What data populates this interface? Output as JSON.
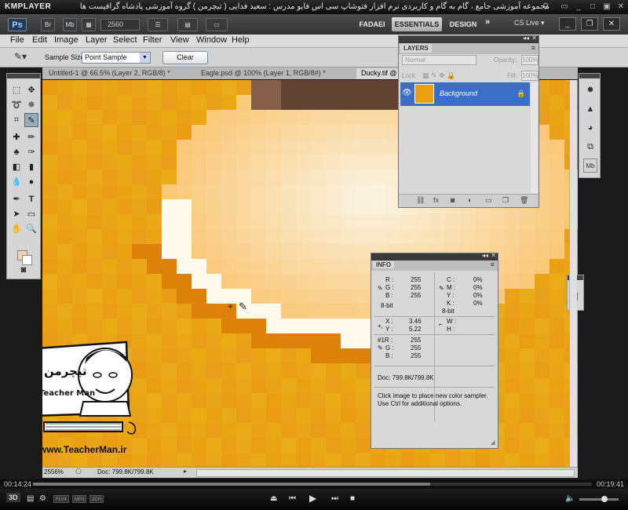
{
  "player": {
    "logo": "KMPLAYER",
    "title": "مجموعه آموزشی جامع ، گام به گام و کاربردی نرم افزار فتوشاپ سی اس فایو   مدرس : سعید فدایی ( تیچرمن ) گروه آموزشی پادشاه گرافیست ها",
    "time_current": "00:14:24",
    "time_total": "00:19:41",
    "progress": 0.71,
    "badges": [
      "FLV4",
      "MP3",
      "2CH"
    ]
  },
  "appbar": {
    "logo": "Ps",
    "br_label": "Br",
    "mb_label": "Mb",
    "zoom": "2560",
    "workspaces": [
      "FADAEI",
      "ESSENTIALS",
      "DESIGN"
    ],
    "active_workspace": "ESSENTIALS",
    "more": "»",
    "cs_live": "CS Live ▾"
  },
  "menu": [
    "File",
    "Edit",
    "Image",
    "Layer",
    "Select",
    "Filter",
    "View",
    "Window",
    "Help"
  ],
  "options": {
    "sample_size_label": "Sample Size:",
    "sample_size_value": "Point Sample",
    "clear_label": "Clear"
  },
  "tabs": [
    {
      "label": "Untitled-1 @ 66.5% (Layer 2, RGB/8) *",
      "active": false
    },
    {
      "label": "Eagle.psd @ 100% (Layer 1, RGB/8#) *",
      "active": false
    },
    {
      "label": "Ducky.tif @ 19.41...",
      "active": true
    }
  ],
  "layers_panel": {
    "tab_label": "LAYERS",
    "blend_mode": "Normal",
    "opacity_label": "Opacity:",
    "opacity_value": "100%",
    "lock_label": "Lock:",
    "fill_label": "Fill:",
    "fill_value": "100%",
    "layer_name": "Background"
  },
  "info_panel": {
    "tab_label": "INFO",
    "rgb": [
      {
        "k": "R :",
        "v": "255"
      },
      {
        "k": "G :",
        "v": "255"
      },
      {
        "k": "B :",
        "v": "255"
      }
    ],
    "rgb_bits": "8-bit",
    "cmyk": [
      {
        "k": "C :",
        "v": "0%"
      },
      {
        "k": "M :",
        "v": "0%"
      },
      {
        "k": "Y :",
        "v": "0%"
      },
      {
        "k": "K :",
        "v": "0%"
      }
    ],
    "cmyk_bits": "8-bit",
    "xy": [
      {
        "k": "X :",
        "v": "3.46"
      },
      {
        "k": "Y :",
        "v": "5.22"
      }
    ],
    "wh": [
      {
        "k": "W :",
        "v": ""
      },
      {
        "k": "H :",
        "v": ""
      }
    ],
    "sampler": [
      {
        "k": "#1R :",
        "v": "255"
      },
      {
        "k": "G :",
        "v": "255"
      },
      {
        "k": "B :",
        "v": "255"
      }
    ],
    "doc": "Doc: 799.8K/799.8K",
    "hint_line1": "Click image to place new color sampler.",
    "hint_line2": "Use Ctrl for additional options."
  },
  "statusbar": {
    "zoom": "2556%",
    "doc": "Doc: 799.8K/799.8K"
  },
  "watermark": {
    "brand_fa": "تیچرمن",
    "brand_en": "Teacher Man",
    "url": "www.TeacherMan.ir"
  },
  "colors": {
    "canvas_orange": "#e9a40f",
    "selection_blue": "#3b6ec8",
    "foreground": "#f5d2b0",
    "background": "#ffffff"
  }
}
